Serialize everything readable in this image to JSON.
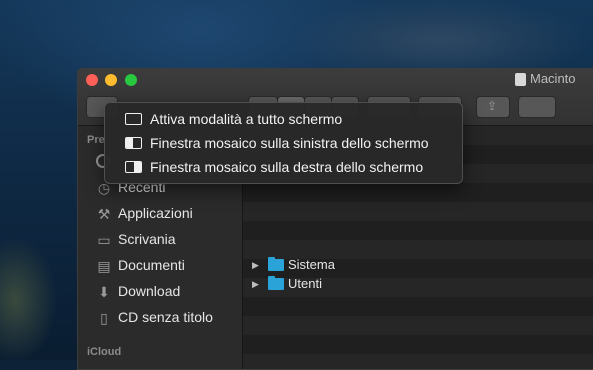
{
  "window": {
    "title": "Macinto"
  },
  "sidebar": {
    "section_favorites": "Pre",
    "section_icloud": "iCloud",
    "items": [
      {
        "label": "Recenti",
        "icon": "clock-icon"
      },
      {
        "label": "Applicazioni",
        "icon": "applications-icon"
      },
      {
        "label": "Scrivania",
        "icon": "desktop-icon"
      },
      {
        "label": "Documenti",
        "icon": "document-icon"
      },
      {
        "label": "Download",
        "icon": "download-icon"
      },
      {
        "label": "CD senza titolo",
        "icon": "file-icon"
      }
    ]
  },
  "files": [
    {
      "name": "Sistema",
      "icon": "folder-icon"
    },
    {
      "name": "Utenti",
      "icon": "folder-icon"
    }
  ],
  "menu": {
    "items": [
      {
        "label": "Attiva modalità a tutto schermo",
        "icon": "fullscreen-icon"
      },
      {
        "label": "Finestra mosaico sulla sinistra dello schermo",
        "icon": "tile-left-icon"
      },
      {
        "label": "Finestra mosaico sulla destra dello schermo",
        "icon": "tile-right-icon"
      }
    ]
  }
}
